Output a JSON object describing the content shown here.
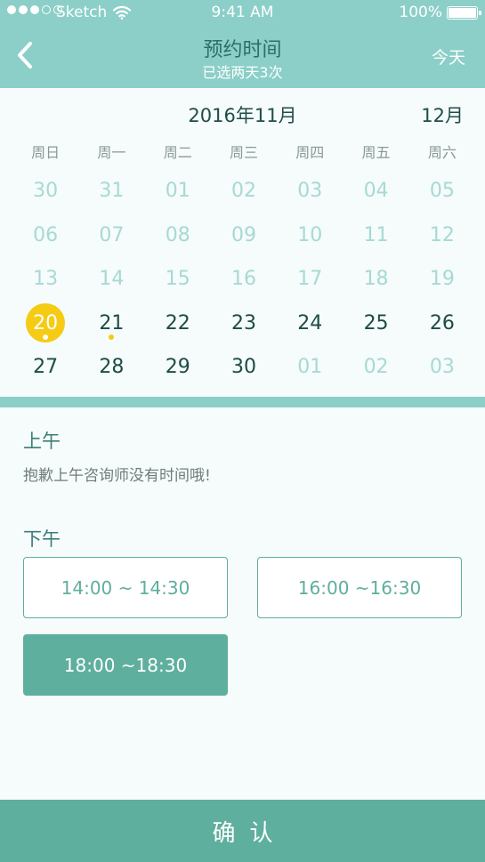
{
  "status_bar": {
    "carrier": "Sketch",
    "time": "9:41 AM",
    "battery": "100%"
  },
  "nav": {
    "title": "预约时间",
    "subtitle": "已选两天3次",
    "today_label": "今天",
    "back_icon": "chevron-left-icon"
  },
  "calendar": {
    "current_month": "2016年11月",
    "next_month": "12月",
    "weekdays": [
      "周日",
      "周一",
      "周二",
      "周三",
      "周四",
      "周五",
      "周六"
    ],
    "days": [
      {
        "label": "30",
        "state": "muted"
      },
      {
        "label": "31",
        "state": "muted"
      },
      {
        "label": "01",
        "state": "muted"
      },
      {
        "label": "02",
        "state": "muted"
      },
      {
        "label": "03",
        "state": "muted"
      },
      {
        "label": "04",
        "state": "muted"
      },
      {
        "label": "05",
        "state": "muted"
      },
      {
        "label": "06",
        "state": "muted"
      },
      {
        "label": "07",
        "state": "muted"
      },
      {
        "label": "08",
        "state": "muted"
      },
      {
        "label": "09",
        "state": "muted"
      },
      {
        "label": "10",
        "state": "muted"
      },
      {
        "label": "11",
        "state": "muted"
      },
      {
        "label": "12",
        "state": "muted"
      },
      {
        "label": "13",
        "state": "muted"
      },
      {
        "label": "14",
        "state": "muted"
      },
      {
        "label": "15",
        "state": "muted"
      },
      {
        "label": "16",
        "state": "muted"
      },
      {
        "label": "17",
        "state": "muted"
      },
      {
        "label": "18",
        "state": "muted"
      },
      {
        "label": "19",
        "state": "muted"
      },
      {
        "label": "20",
        "state": "selected",
        "mark": "white"
      },
      {
        "label": "21",
        "state": "active",
        "mark": "yellow"
      },
      {
        "label": "22",
        "state": "active"
      },
      {
        "label": "23",
        "state": "active"
      },
      {
        "label": "24",
        "state": "active"
      },
      {
        "label": "25",
        "state": "active"
      },
      {
        "label": "26",
        "state": "active"
      },
      {
        "label": "27",
        "state": "active"
      },
      {
        "label": "28",
        "state": "active"
      },
      {
        "label": "29",
        "state": "active"
      },
      {
        "label": "30",
        "state": "active"
      },
      {
        "label": "01",
        "state": "muted"
      },
      {
        "label": "02",
        "state": "muted"
      },
      {
        "label": "03",
        "state": "muted"
      }
    ]
  },
  "morning": {
    "title": "上午",
    "note": "抱歉上午咨询师没有时间哦!"
  },
  "afternoon": {
    "title": "下午",
    "slots": [
      {
        "label": "14:00 ~ 14:30",
        "selected": false
      },
      {
        "label": "16:00 ~16:30",
        "selected": false
      },
      {
        "label": "18:00 ~18:30",
        "selected": true
      }
    ]
  },
  "confirm_label": "确认",
  "colors": {
    "header": "#8bcfc8",
    "accent": "#5faf9e",
    "selected_day": "#f5cb14",
    "muted_day": "#a6dad4",
    "active_day": "#1d4c45"
  }
}
